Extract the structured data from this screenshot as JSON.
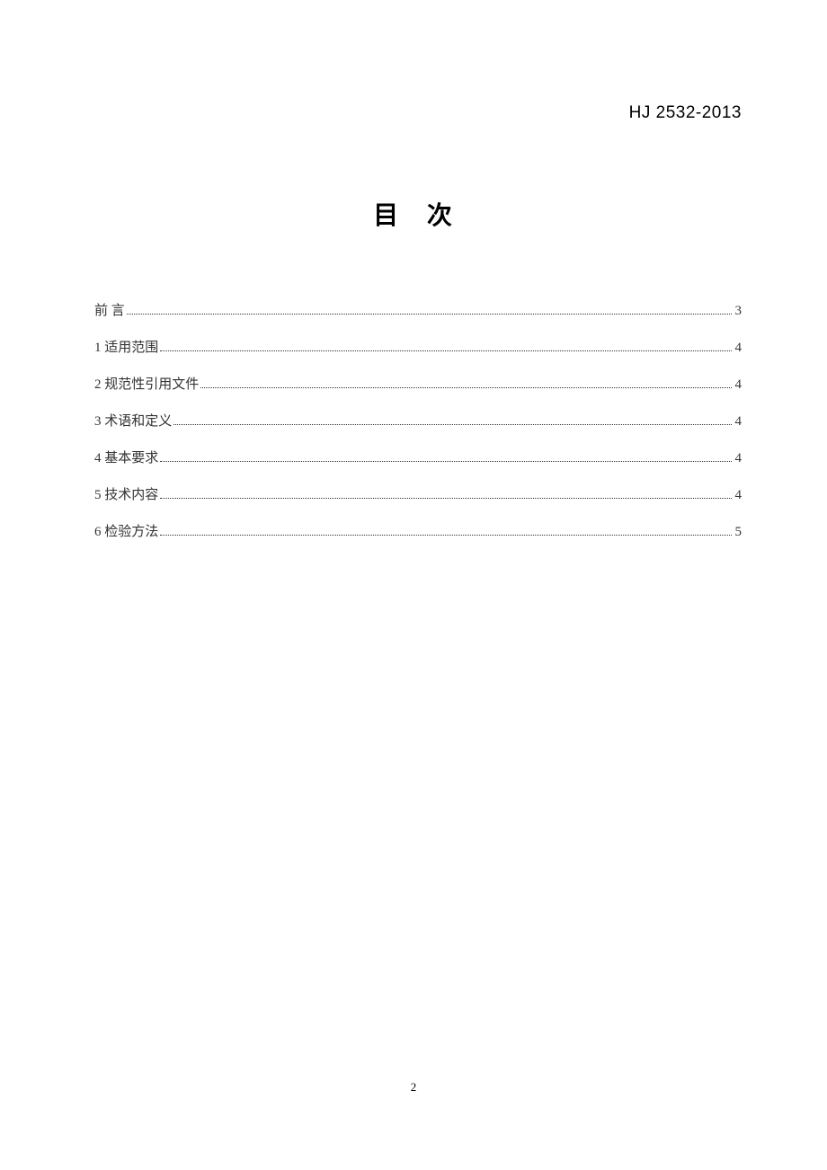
{
  "header": {
    "code": "HJ 2532-2013"
  },
  "title": "目 次",
  "toc": {
    "entries": [
      {
        "label": "前    言",
        "page": "3",
        "preface": true
      },
      {
        "label": "1 适用范围",
        "page": "4",
        "preface": false
      },
      {
        "label": "2 规范性引用文件",
        "page": "4",
        "preface": false
      },
      {
        "label": "3 术语和定义",
        "page": "4",
        "preface": false
      },
      {
        "label": "4 基本要求",
        "page": "4",
        "preface": false
      },
      {
        "label": "5 技术内容",
        "page": "4",
        "preface": false
      },
      {
        "label": "6 检验方法",
        "page": "5",
        "preface": false
      }
    ]
  },
  "page_number": "2"
}
